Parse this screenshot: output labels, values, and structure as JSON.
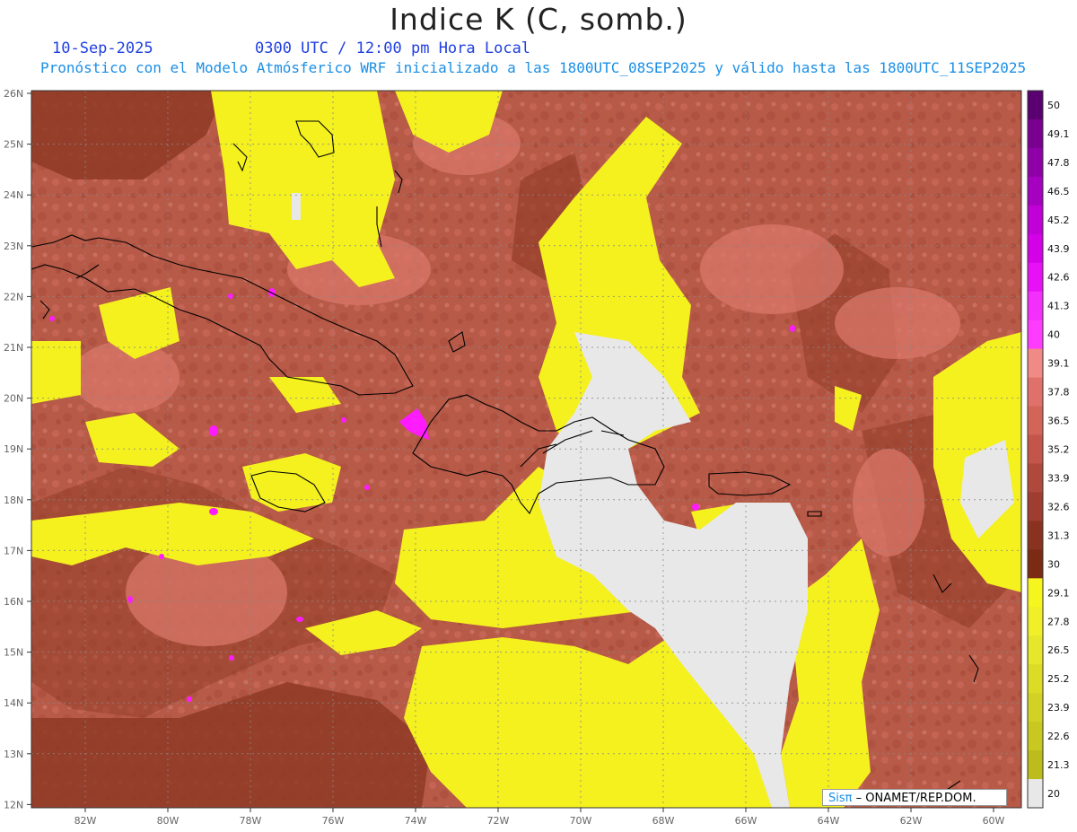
{
  "header": {
    "title": "Indice K (C, somb.)",
    "date": "10-Sep-2025",
    "time": "0300 UTC / 12:00 pm Hora Local",
    "description": "Pronóstico con el Modelo Atmósferico WRF inicializado a las 1800UTC_08SEP2025 y válido hasta las  1800UTC_11SEP2025"
  },
  "map": {
    "lat_labels": [
      "26N",
      "25N",
      "24N",
      "23N",
      "22N",
      "21N",
      "20N",
      "19N",
      "18N",
      "17N",
      "16N",
      "15N",
      "14N",
      "13N",
      "12N"
    ],
    "lon_labels": [
      "82W",
      "80W",
      "78W",
      "76W",
      "74W",
      "72W",
      "70W",
      "68W",
      "66W",
      "64W",
      "62W",
      "60W"
    ],
    "grid_lines": "dotted",
    "colors": {
      "background_red": "#b75a48",
      "deep_red": "#8f3a26",
      "light_red": "#d9776a",
      "yellow": "#f4f11f",
      "gray": "#e8e8e8",
      "magenta": "#ff1aff",
      "coast": "#000000"
    }
  },
  "colorbar": {
    "labels": [
      "50",
      "49.1",
      "47.8",
      "46.5",
      "45.2",
      "43.9",
      "42.6",
      "41.3",
      "40",
      "39.1",
      "37.8",
      "36.5",
      "35.2",
      "33.9",
      "32.6",
      "31.3",
      "30",
      "29.1",
      "27.8",
      "26.5",
      "25.2",
      "23.9",
      "22.6",
      "21.3",
      "20"
    ],
    "colors": [
      "#5a0070",
      "#7a0090",
      "#8f00a8",
      "#a600c0",
      "#c000d6",
      "#d400e8",
      "#e810f6",
      "#f52ffb",
      "#ff3bff",
      "#f08a84",
      "#e0716a",
      "#d26458",
      "#c3554a",
      "#b0483c",
      "#9e3d30",
      "#8a3220",
      "#7b2a14",
      "#f6f51e",
      "#f0ef28",
      "#e6e62a",
      "#dcdc26",
      "#d2d224",
      "#c8c820",
      "#bcbc1c",
      "#e8e8e8"
    ]
  },
  "footer": {
    "credit_sis": "Sisπ",
    "credit_text": " – ONAMET/REP.DOM."
  }
}
